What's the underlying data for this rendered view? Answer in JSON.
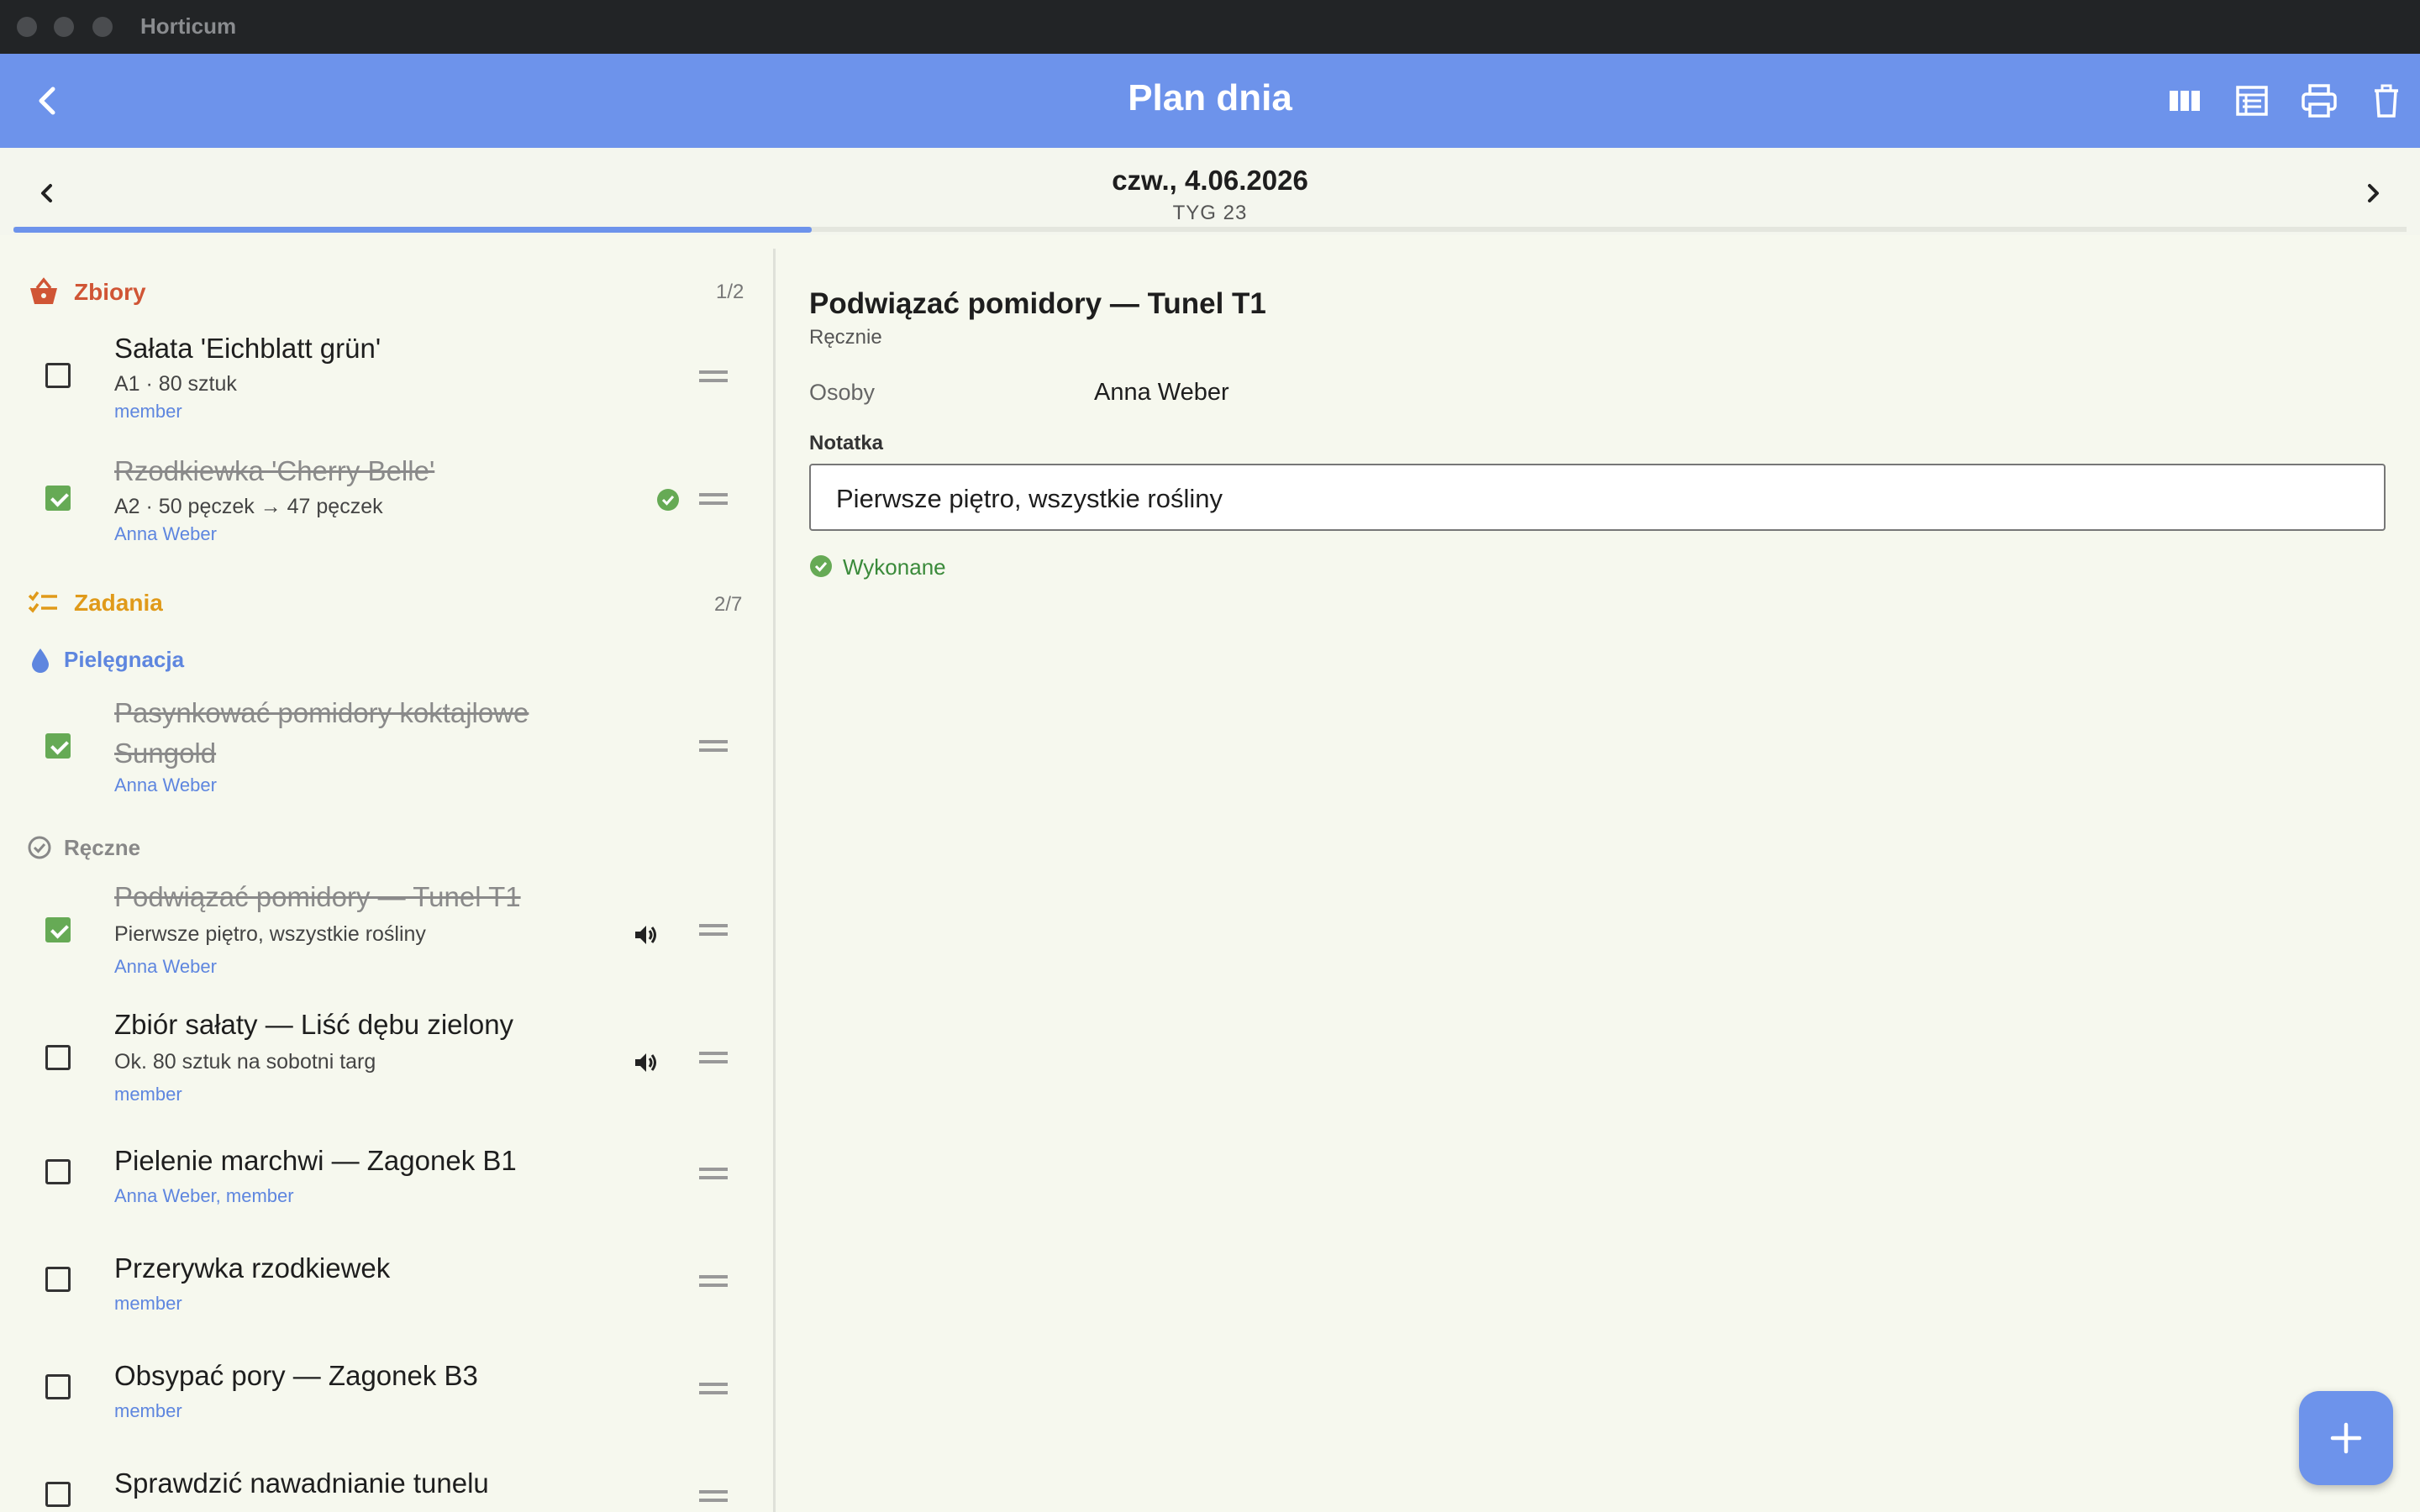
{
  "window": {
    "title": "Horticum"
  },
  "appbar": {
    "title": "Plan dnia"
  },
  "datebar": {
    "date": "czw., 4.06.2026",
    "week": "TYG 23",
    "progress": 0.333
  },
  "sections": {
    "harvest": {
      "title": "Zbiory",
      "count": "1/2"
    },
    "tasks": {
      "title": "Zadania",
      "count": "2/7"
    },
    "care": {
      "title": "Pielęgnacja"
    },
    "manual": {
      "title": "Ręczne"
    }
  },
  "harvest_items": [
    {
      "title": "Sałata 'Eichblatt grün'",
      "sub": "A1 · 80 sztuk",
      "who": "member",
      "done": false
    },
    {
      "title": "Rzodkiewka 'Cherry Belle'",
      "sub": "A2 · 50 pęczek → 47 pęczek",
      "who": "Anna Weber",
      "done": true
    }
  ],
  "care_items": [
    {
      "title_line1": "Pasynkować pomidory koktajlowe",
      "title_line2": "Sungold",
      "who": "Anna Weber",
      "done": true
    }
  ],
  "manual_items": [
    {
      "title": "Podwiązać pomidory — Tunel T1",
      "sub": "Pierwsze piętro, wszystkie rośliny",
      "who": "Anna Weber",
      "done": true
    },
    {
      "title": "Zbiór sałaty — Liść dębu zielony",
      "sub": "Ok. 80 sztuk na sobotni targ",
      "who": "member",
      "done": false
    },
    {
      "title": "Pielenie marchwi — Zagonek B1",
      "who": "Anna Weber, member",
      "done": false
    },
    {
      "title": "Przerywka rzodkiewek",
      "who": "member",
      "done": false
    },
    {
      "title": "Obsypać pory — Zagonek B3",
      "who": "member",
      "done": false
    },
    {
      "title": "Sprawdzić nawadnianie tunelu",
      "done": false
    }
  ],
  "detail": {
    "title": "Podwiązać pomidory — Tunel T1",
    "source": "Ręcznie",
    "people_label": "Osoby",
    "people_value": "Anna Weber",
    "note_label": "Notatka",
    "note_value": "Pierwsze piętro, wszystkie rośliny",
    "status": "Wykonane"
  },
  "colors": {
    "accent": "#6d93eb",
    "harvest": "#d05535",
    "tasks": "#e09a1a",
    "done": "#66aa55"
  },
  "icons": [
    "back-icon",
    "columns-icon",
    "table-icon",
    "print-icon",
    "trash-icon",
    "prev-day-icon",
    "next-day-icon",
    "basket-icon",
    "checklist-icon",
    "drop-icon",
    "check-circle-icon",
    "speaker-icon",
    "drag-handle-icon",
    "plus-icon"
  ]
}
